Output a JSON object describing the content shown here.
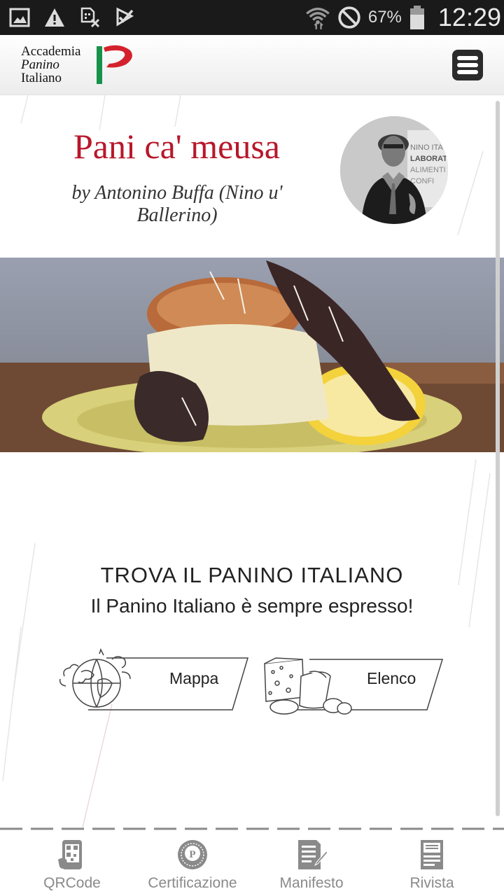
{
  "status_bar": {
    "battery_percent": "67%",
    "time": "12:29",
    "left_icons": [
      "gallery-icon",
      "warning-icon",
      "sim-off-icon",
      "check-done-icon"
    ],
    "right_icons": [
      "wifi-icon",
      "do-not-disturb-icon",
      "battery-icon"
    ]
  },
  "header": {
    "logo_lines": [
      "Accademia",
      "Panino",
      "Italiano"
    ],
    "brand_colors": {
      "red": "#d3222e",
      "green": "#17924a"
    }
  },
  "recipe": {
    "title": "Pani ca' meusa",
    "author": "by Antonino Buffa (Nino u' Ballerino)"
  },
  "find_section": {
    "heading": "TROVA IL PANINO ITALIANO",
    "subheading": "Il Panino Italiano è sempre espresso!",
    "buttons": [
      {
        "label": "Mappa",
        "icon": "globe-icon"
      },
      {
        "label": "Elenco",
        "icon": "cheese-icon"
      }
    ]
  },
  "bottom_nav": {
    "items": [
      {
        "label": "QRCode",
        "icon": "qrcode-phone-icon"
      },
      {
        "label": "Certificazione",
        "icon": "certification-seal-icon"
      },
      {
        "label": "Manifesto",
        "icon": "manifesto-document-icon"
      },
      {
        "label": "Rivista",
        "icon": "magazine-icon"
      }
    ]
  },
  "colors": {
    "accent_title": "#b8172b",
    "nav_icon": "#8a8a8a",
    "status_bar_bg": "#1a1a1a"
  }
}
